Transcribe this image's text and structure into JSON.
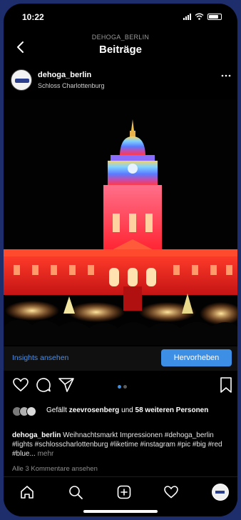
{
  "status_bar": {
    "time": "10:22"
  },
  "nav": {
    "subtitle": "DEHOGA_BERLIN",
    "title": "Beiträge"
  },
  "post": {
    "username": "dehoga_berlin",
    "location": "Schloss Charlottenburg"
  },
  "insights": {
    "link": "Insights ansehen",
    "button": "Hervorheben"
  },
  "carousel": {
    "count": 2,
    "active": 1
  },
  "likes": {
    "prefix": "Gefällt",
    "user": "zeevrosenberg",
    "middle": "und",
    "others": "58 weiteren Personen"
  },
  "caption": {
    "username": "dehoga_berlin",
    "text": "Weihnachtsmarkt Impressionen #dehoga_berlin #lights #schlosscharlottenburg #liketime #instagram #pic #big #red #blue...",
    "more": "mehr"
  },
  "comments_link": "Alle 3 Kommentare ansehen",
  "icons": {
    "back": "chevron-left-icon",
    "more": "ellipsis-icon",
    "like": "heart-icon",
    "comment": "comment-icon",
    "share": "send-icon",
    "save": "bookmark-icon",
    "home": "home-icon",
    "search": "search-icon",
    "add": "add-post-icon",
    "activity": "heart-icon"
  },
  "colors": {
    "accent": "#3d8fe6",
    "link": "#4d8fe8",
    "background": "#000000",
    "frame": "#1e2d6b"
  }
}
